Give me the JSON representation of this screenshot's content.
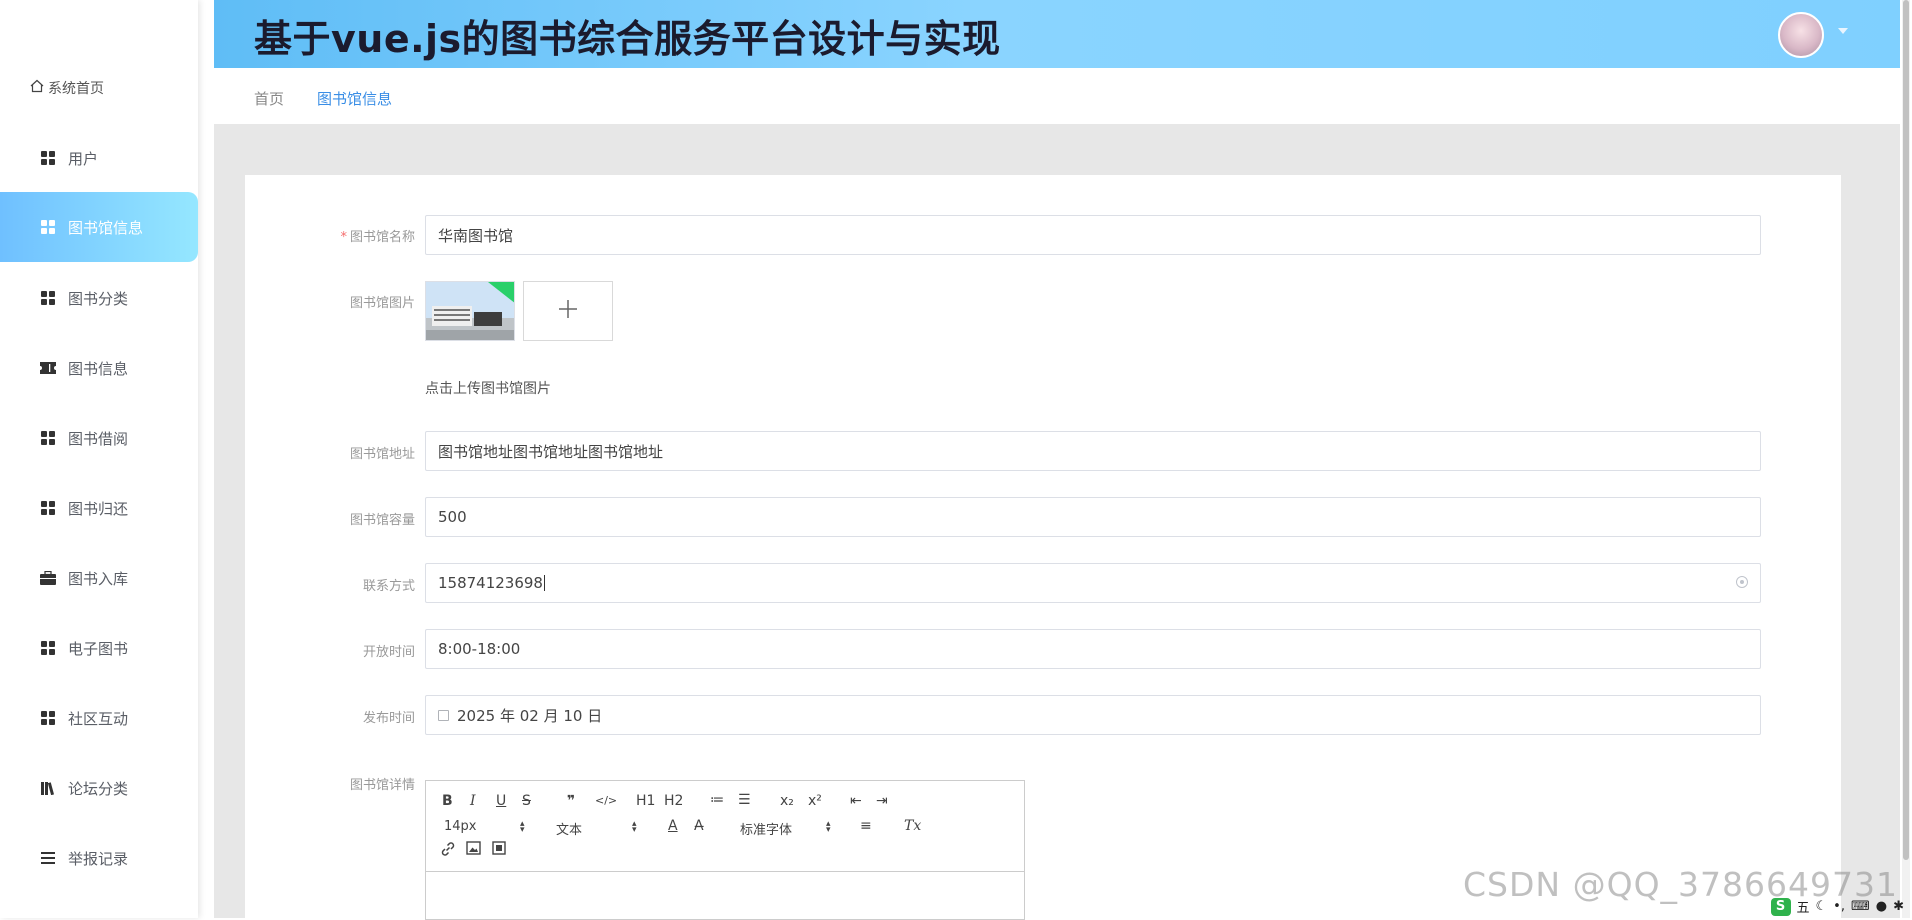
{
  "app": {
    "title": "基于vue.js的图书综合服务平台设计与实现"
  },
  "sidebar": {
    "home_label": "系统首页",
    "items": [
      {
        "label": "用户",
        "icon": "grid-icon"
      },
      {
        "label": "图书馆信息",
        "icon": "grid-icon",
        "active": true
      },
      {
        "label": "图书分类",
        "icon": "grid-icon"
      },
      {
        "label": "图书信息",
        "icon": "ticket-icon"
      },
      {
        "label": "图书借阅",
        "icon": "grid-icon"
      },
      {
        "label": "图书归还",
        "icon": "grid-icon"
      },
      {
        "label": "图书入库",
        "icon": "briefcase-icon"
      },
      {
        "label": "电子图书",
        "icon": "grid-icon"
      },
      {
        "label": "社区互动",
        "icon": "grid-icon"
      },
      {
        "label": "论坛分类",
        "icon": "books-icon"
      },
      {
        "label": "举报记录",
        "icon": "list-icon"
      }
    ]
  },
  "breadcrumb": {
    "home": "首页",
    "current": "图书馆信息"
  },
  "form": {
    "name": {
      "label": "图书馆名称",
      "value": "华南图书馆",
      "required": true
    },
    "image": {
      "label": "图书馆图片",
      "hint": "点击上传图书馆图片",
      "upload_symbol": "+"
    },
    "address": {
      "label": "图书馆地址",
      "value": "图书馆地址图书馆地址图书馆地址"
    },
    "capacity": {
      "label": "图书馆容量",
      "value": "500"
    },
    "contact": {
      "label": "联系方式",
      "value": "15874123698"
    },
    "hours": {
      "label": "开放时间",
      "value": "8:00-18:00"
    },
    "publish_time": {
      "label": "发布时间",
      "value": "2025 年 02 月 10 日"
    },
    "details": {
      "label": "图书馆详情"
    }
  },
  "editor": {
    "row1": [
      "B",
      "I",
      "U",
      "S",
      "❞",
      "</>",
      "H1",
      "H2",
      "≔",
      "☰",
      "x₂",
      "x²",
      "⇤",
      "⇥"
    ],
    "size_picker": "14px",
    "format_picker": "文本",
    "font_picker": "标准字体",
    "row2_tools": [
      "A",
      "A̶",
      "≡",
      "Tx"
    ]
  },
  "watermark": "CSDN @QQ_3786649731",
  "ime": {
    "logo": "S",
    "label": "五"
  },
  "colors": {
    "accent": "#3a8ee6",
    "header_gradient_start": "#5fbdf6",
    "header_gradient_end": "#8ad4ff",
    "active_menu_start": "#6fc0ff",
    "active_menu_end": "#95e7ff",
    "required": "#f56c6c"
  }
}
